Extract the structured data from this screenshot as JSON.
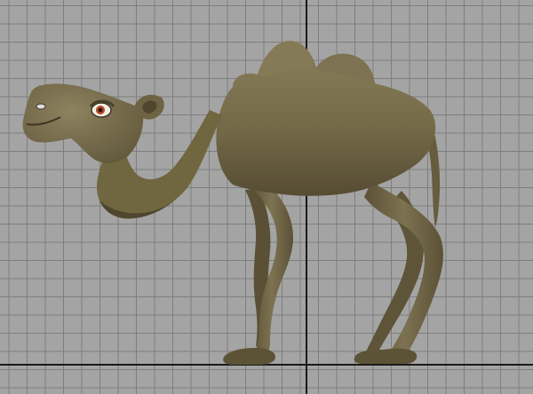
{
  "viewport": {
    "background_color": "#a4a4a4",
    "grid_line_color": "#7e7e7e",
    "axis_color": "#1a1a1a"
  },
  "model": {
    "subject": "camel",
    "body_color": "#736847",
    "shadow_color": "#4e4530",
    "highlight_color": "#8d8360",
    "eye_iris_color": "#b4431f"
  }
}
